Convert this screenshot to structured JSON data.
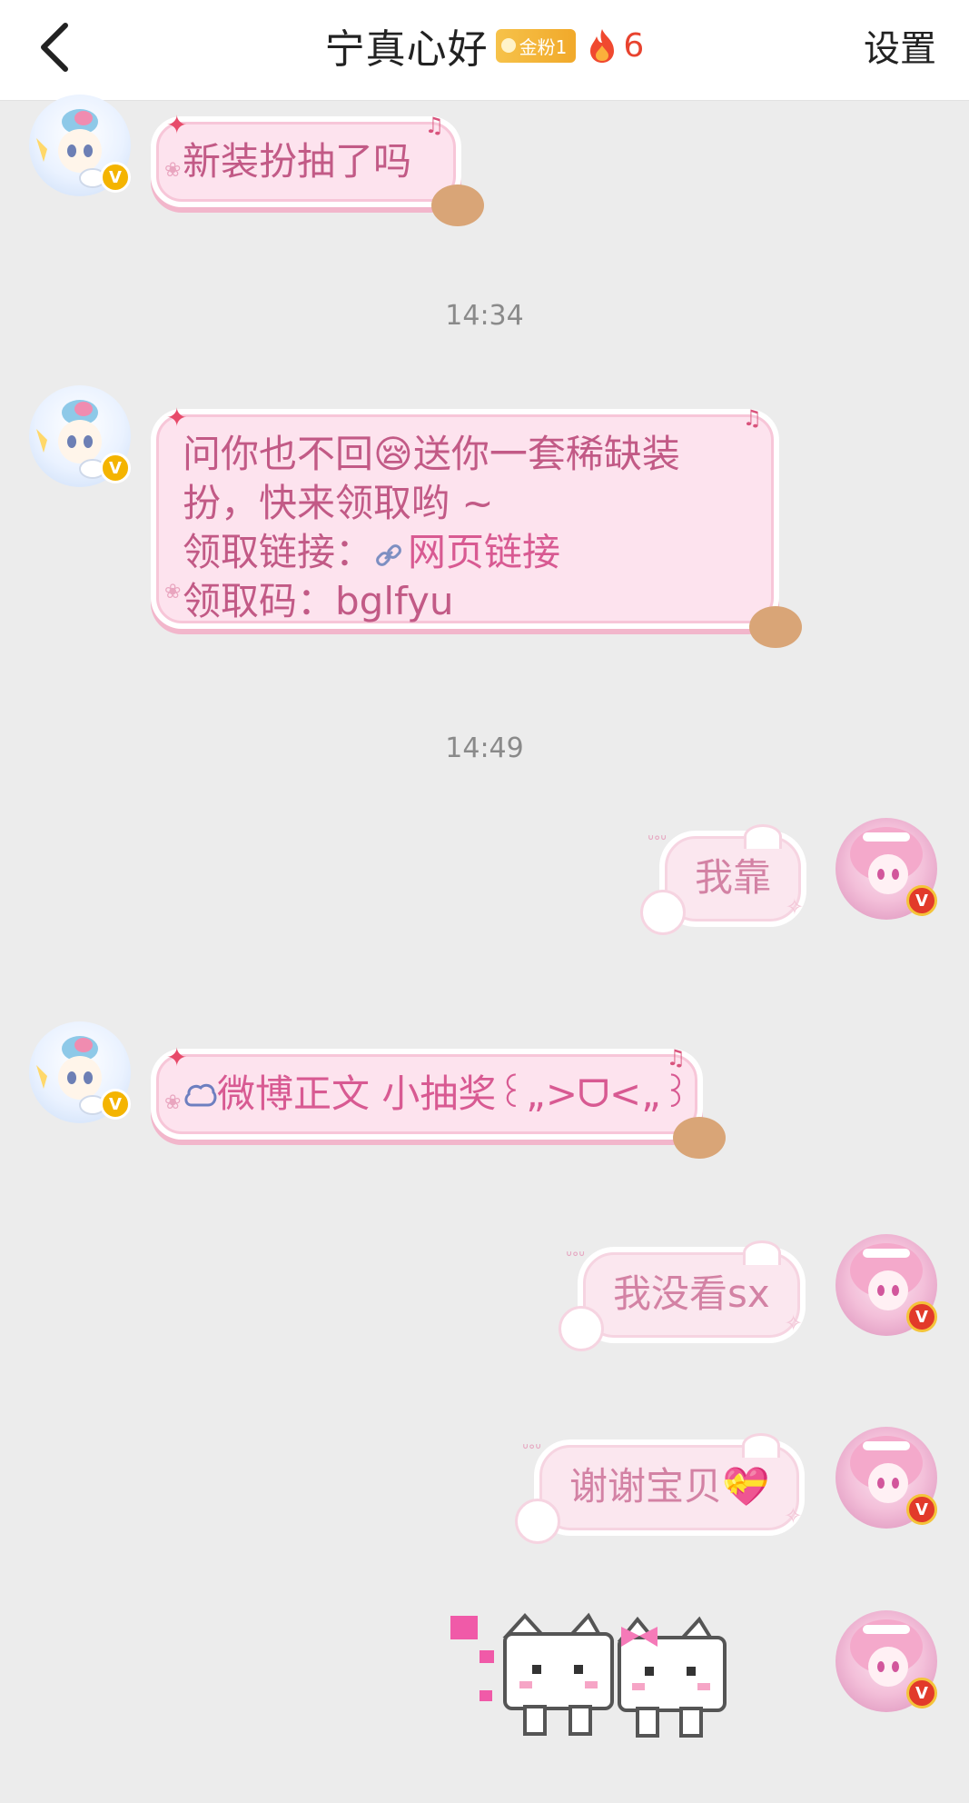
{
  "header": {
    "title": "宁真心好",
    "fan_badge": "金粉1",
    "fire_count": "6",
    "settings_label": "设置"
  },
  "colors": {
    "background": "#ececec",
    "bubble_pink": "#fde3ee",
    "link_pink": "#d85a92",
    "fire_red": "#e8432f",
    "badge_gold": "#f4b400"
  },
  "timestamps": [
    "14:34",
    "14:49"
  ],
  "messages": [
    {
      "side": "left",
      "text": "新装扮抽了吗"
    },
    {
      "side": "left",
      "lines": [
        "问你也不回",
        "送你一套稀缺装",
        "扮，快来领取哟 ~",
        "领取链接：",
        "领取码：bglfyu"
      ],
      "emoji": "😪",
      "link_text": "网页链接"
    },
    {
      "side": "right",
      "text": "我靠"
    },
    {
      "side": "left",
      "icon": "weibo-post-icon",
      "text": "微博正文 小抽奖꒰„>ᗜ<„꒱"
    },
    {
      "side": "right",
      "text": "我没看sx"
    },
    {
      "side": "right",
      "text": "谢谢宝贝",
      "emoji": "💝"
    },
    {
      "side": "right",
      "sticker": "pixel-cats-sticker"
    }
  ]
}
